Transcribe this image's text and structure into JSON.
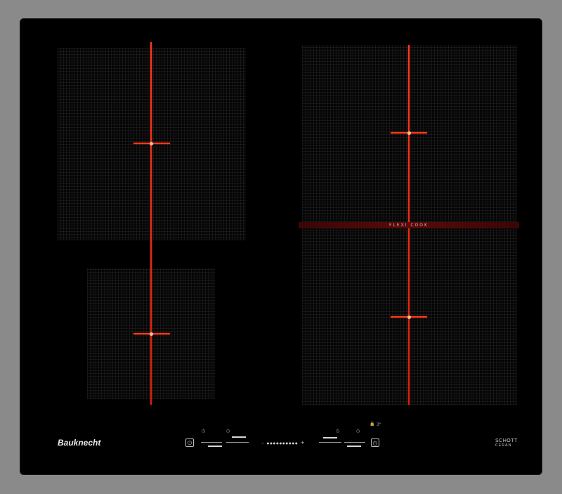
{
  "brand": {
    "name": "Bauknecht"
  },
  "panel": {
    "label": "FLEXI COOK"
  },
  "glass": {
    "line1": "SCHOTT",
    "line2": "CERAN"
  },
  "controls": {
    "power_symbol": "⏻",
    "timer_symbol": "◷",
    "lock_symbol": "🔒",
    "lock_label": "3\"",
    "slider_minus": "–",
    "slider_plus": "+",
    "slider_dots": "●●●●●●●●●●"
  },
  "colors": {
    "frame": "#8a8a8a",
    "glass": "#000000",
    "heating_line": "#ff3a1a",
    "flexi_band": "#5a0a0a"
  }
}
